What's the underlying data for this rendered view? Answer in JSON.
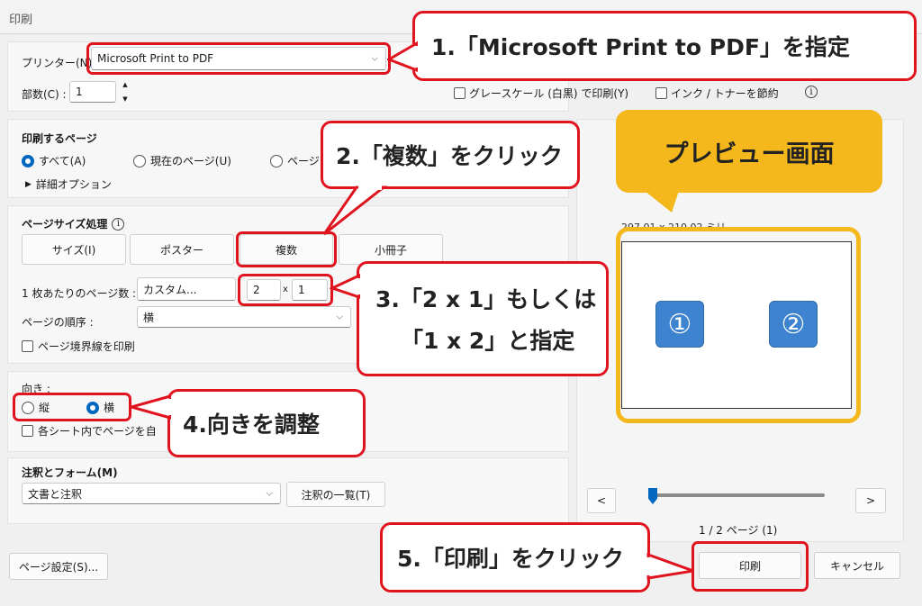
{
  "window": {
    "title": "印刷"
  },
  "printer": {
    "label": "プリンター(N)",
    "value": "Microsoft Print to PDF"
  },
  "copies": {
    "label": "部数(C) :",
    "value": "1"
  },
  "options": {
    "grayscale": "グレースケール (白黒) で印刷(Y)",
    "save_ink": "インク / トナーを節約"
  },
  "pages_to_print": {
    "title": "印刷するページ",
    "all": "すべて(A)",
    "current": "現在のページ(U)",
    "pages": "ページ",
    "more": "詳細オプション"
  },
  "page_sizing": {
    "title": "ページサイズ処理",
    "tabs": [
      "サイズ(I)",
      "ポスター",
      "複数",
      "小冊子"
    ],
    "per_sheet_label": "1 枚あたりのページ数 :",
    "per_sheet_value": "カスタム...",
    "cols": "2",
    "x": "x",
    "rows": "1",
    "order_label": "ページの順序 :",
    "order_value": "横",
    "border": "ページ境界線を印刷"
  },
  "orientation": {
    "title": "向き :",
    "portrait": "縦",
    "landscape": "横",
    "auto": "各シート内でページを自"
  },
  "annotations": {
    "title": "注釈とフォーム(M)",
    "value": "文書と注釈",
    "summary_button": "注釈の一覧(T)"
  },
  "preview": {
    "size_text": "297.01 x 210.02 ミリ",
    "pages": [
      "①",
      "②"
    ],
    "prev": "<",
    "next": ">",
    "counter": "1 / 2 ページ (1)",
    "slider_fraction": 0.0
  },
  "buttons": {
    "page_setup": "ページ設定(S)...",
    "print": "印刷",
    "cancel": "キャンセル"
  },
  "callouts": {
    "c1": "1.「Microsoft Print to PDF」を指定",
    "c2": "2.「複数」をクリック",
    "c3a": "3.「2 x 1」もしくは",
    "c3b": "「1 x 2」と指定",
    "c4": "4.向きを調整",
    "c5": "5.「印刷」をクリック",
    "preview_label": "プレビュー画面"
  },
  "colors": {
    "accent": "#0067c0",
    "callout_red": "#e0141e",
    "preview_yellow": "#f4b81c"
  }
}
